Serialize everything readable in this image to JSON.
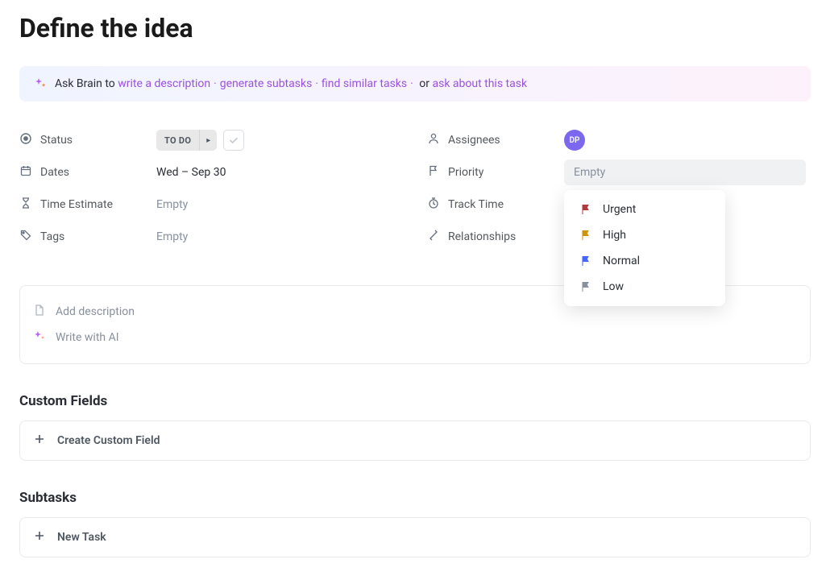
{
  "title": "Define the idea",
  "brain": {
    "prefix": "Ask Brain to ",
    "links": [
      "write a description",
      "generate subtasks",
      "find similar tasks"
    ],
    "or_text": " or ",
    "last_link": "ask about this task"
  },
  "fields": {
    "status": {
      "label": "Status",
      "value": "TO DO"
    },
    "dates": {
      "label": "Dates",
      "value": "Wed – Sep 30"
    },
    "time_estimate": {
      "label": "Time Estimate",
      "value": "Empty"
    },
    "tags": {
      "label": "Tags",
      "value": "Empty"
    },
    "assignees": {
      "label": "Assignees",
      "avatar": "DP"
    },
    "priority": {
      "label": "Priority",
      "value": "Empty"
    },
    "track_time": {
      "label": "Track Time"
    },
    "relationships": {
      "label": "Relationships"
    }
  },
  "priority_options": [
    {
      "label": "Urgent",
      "color": "#b13a41"
    },
    {
      "label": "High",
      "color": "#cf940a"
    },
    {
      "label": "Normal",
      "color": "#4466ff"
    },
    {
      "label": "Low",
      "color": "#87909e"
    }
  ],
  "description": {
    "add": "Add description",
    "ai": "Write with AI"
  },
  "custom_fields": {
    "heading": "Custom Fields",
    "action": "Create Custom Field"
  },
  "subtasks": {
    "heading": "Subtasks",
    "action": "New Task"
  }
}
